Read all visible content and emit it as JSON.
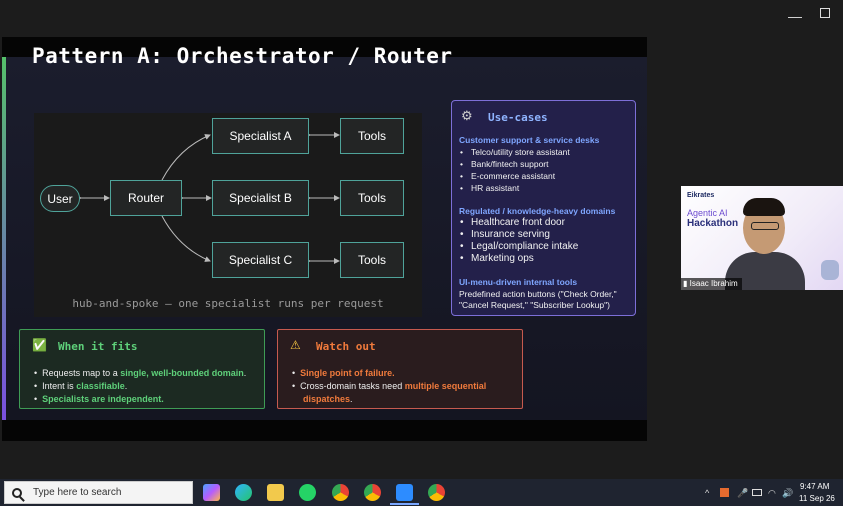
{
  "window": {
    "minimize": "—",
    "restore": ""
  },
  "slide": {
    "title": "Pattern A: Orchestrator / Router",
    "diagram": {
      "user": "User",
      "router": "Router",
      "specialists": [
        "Specialist A",
        "Specialist B",
        "Specialist C"
      ],
      "tools": [
        "Tools",
        "Tools",
        "Tools"
      ],
      "caption": "hub-and-spoke — one specialist runs per request"
    },
    "use_cases": {
      "title": "Use-cases",
      "sections": [
        {
          "heading": "Customer support & service desks",
          "items": [
            "Telco/utility store assistant",
            "Bank/fintech support",
            "E-commerce assistant",
            "HR assistant"
          ]
        },
        {
          "heading": "Regulated / knowledge-heavy domains",
          "items": [
            "Healthcare front door",
            "Insurance serving",
            "Legal/compliance intake",
            "Marketing ops"
          ]
        },
        {
          "heading": "UI-menu-driven internal tools",
          "lines": [
            "Predefined action buttons (\"Check Order,\"",
            "\"Cancel Request,\" \"Subscriber Lookup\")"
          ]
        }
      ]
    },
    "when_it_fits": {
      "title": "When it fits",
      "line1_pre": "Requests map to a ",
      "line1_hl": "single, well-bounded domain",
      "line1_post": ".",
      "line2_pre": "Intent is ",
      "line2_hl": "classifiable",
      "line2_post": ".",
      "line3_hl": "Specialists are independent."
    },
    "watch_out": {
      "title": "Watch out",
      "line1_hl": "Single point of failure.",
      "line2_pre": "Cross-domain tasks need ",
      "line2_hl": "multiple sequential",
      "line3_hl": "dispatches",
      "line3_post": "."
    }
  },
  "webcam": {
    "brand": "Eikrates",
    "agentic": "Agentic AI",
    "hackathon": "Hackathon",
    "name": "Isaac Ibrahim"
  },
  "taskbar": {
    "search_placeholder": "Type here to search",
    "time": "9:47 AM",
    "date": "11 Sep 26"
  },
  "colors": {
    "accent_green": "#5ed07a",
    "accent_orange": "#f07a3c",
    "usecase_heading": "#7fa6ff",
    "diagram_border": "#4fa39a"
  }
}
